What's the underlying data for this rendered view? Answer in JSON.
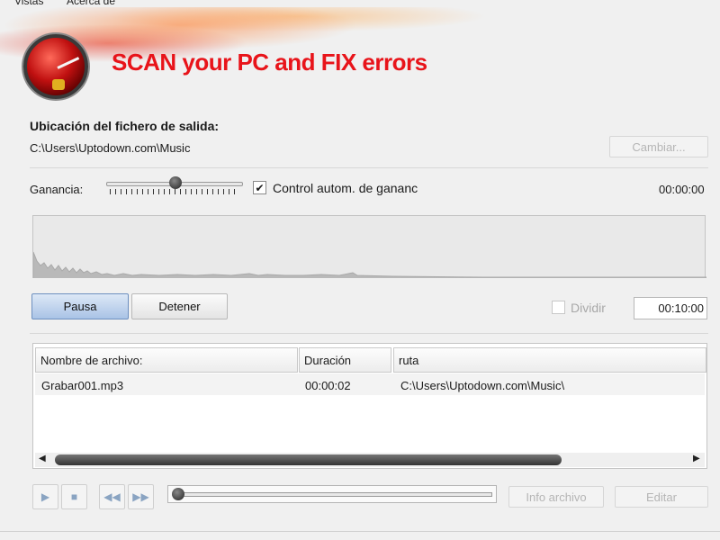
{
  "menu": {
    "items": [
      "Vistas",
      "Acerca de"
    ]
  },
  "banner": {
    "title": "SCAN your PC and FIX errors"
  },
  "output": {
    "label": "Ubicación del fichero de salida:",
    "path": "C:\\Users\\Uptodown.com\\Music",
    "change_button": "Cambiar..."
  },
  "gain": {
    "label": "Ganancia:",
    "level": 0.48,
    "auto_checked": true,
    "auto_label": "Control autom. de gananc",
    "elapsed": "00:00:00"
  },
  "controls": {
    "pause_button": "Pausa",
    "stop_button": "Detener",
    "divide_checked": false,
    "divide_label": "Dividir",
    "divide_time": "00:10:00"
  },
  "table": {
    "columns": [
      "Nombre de archivo:",
      "Duración",
      "ruta"
    ],
    "rows": [
      {
        "name": "Grabar001.mp3",
        "duration": "00:00:02",
        "path": "C:\\Users\\Uptodown.com\\Music\\"
      }
    ]
  },
  "player": {
    "play_icon": "play-icon",
    "stop_icon": "stop-icon",
    "rewind_icon": "rewind-icon",
    "forward_icon": "fast-forward-icon",
    "position": 0.0,
    "info_button": "Info archivo",
    "edit_button": "Editar"
  },
  "colors": {
    "title_red": "#e8141a",
    "accent_blue": "#a9c3e6"
  }
}
